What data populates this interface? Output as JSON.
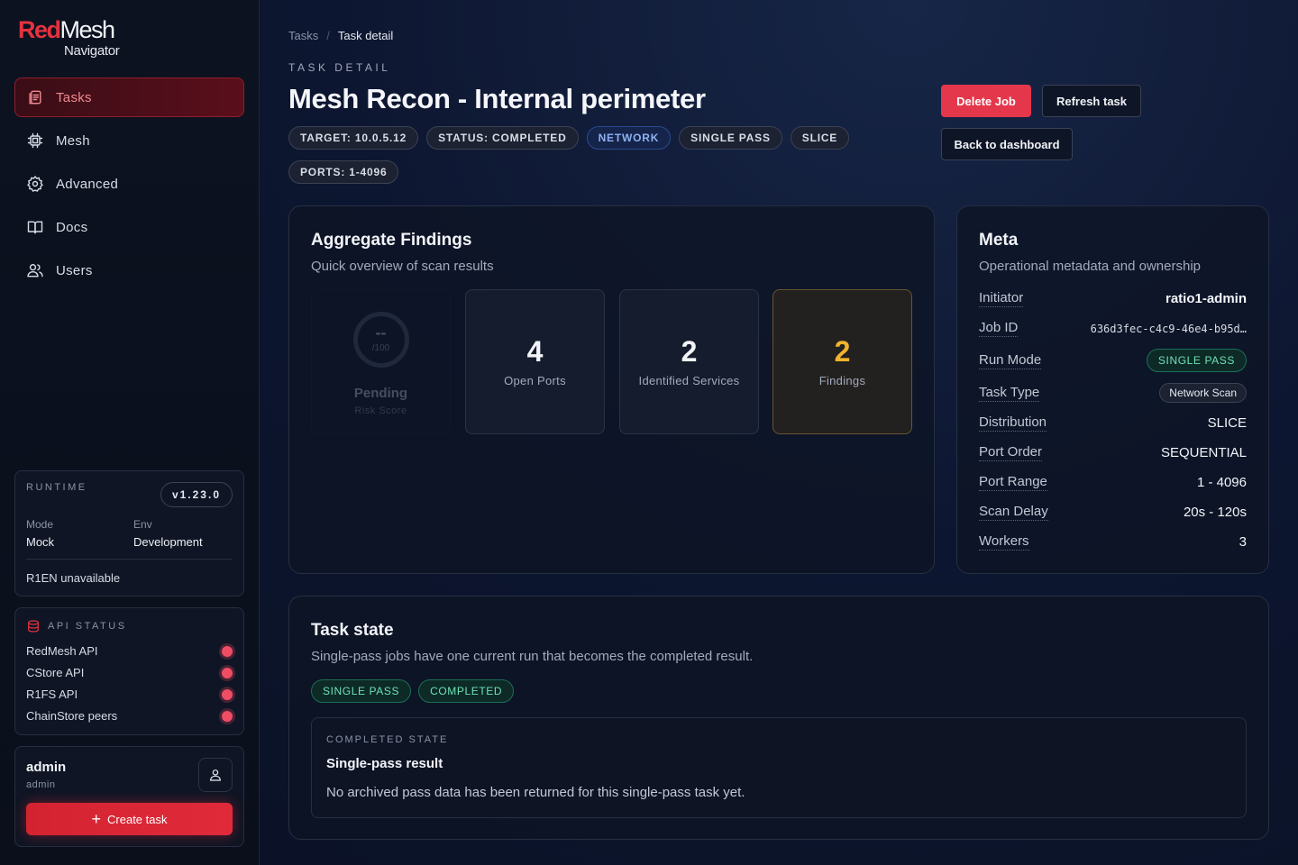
{
  "brand": {
    "part1": "Red",
    "part2": "Mesh",
    "part3": "Navigator"
  },
  "nav": [
    {
      "label": "Tasks",
      "icon": "tasks-icon",
      "active": true
    },
    {
      "label": "Mesh",
      "icon": "chip-icon"
    },
    {
      "label": "Advanced",
      "icon": "gear-icon"
    },
    {
      "label": "Docs",
      "icon": "book-icon"
    },
    {
      "label": "Users",
      "icon": "users-icon"
    }
  ],
  "runtime": {
    "caption": "RUNTIME",
    "version": "v1.23.0",
    "mode_label": "Mode",
    "mode_value": "Mock",
    "env_label": "Env",
    "env_value": "Development",
    "r1en": "R1EN unavailable"
  },
  "api_status": {
    "caption": "API STATUS",
    "items": [
      {
        "label": "RedMesh API",
        "status_color": "#ef4d64"
      },
      {
        "label": "CStore API",
        "status_color": "#ef4d64"
      },
      {
        "label": "R1FS API",
        "status_color": "#ef4d64"
      },
      {
        "label": "ChainStore peers",
        "status_color": "#ef4d64"
      }
    ]
  },
  "user": {
    "name": "admin",
    "role": "admin",
    "create_label": "Create task"
  },
  "breadcrumb": {
    "root": "Tasks",
    "sep": "/",
    "current": "Task detail"
  },
  "header": {
    "eyebrow": "TASK DETAIL",
    "title": "Mesh Recon - Internal perimeter",
    "tags": [
      "TARGET: 10.0.5.12",
      "STATUS: COMPLETED",
      "NETWORK",
      "SINGLE PASS",
      "SLICE",
      "PORTS: 1-4096"
    ],
    "delete_label": "Delete Job",
    "refresh_label": "Refresh task",
    "back_label": "Back to dashboard"
  },
  "aggregate": {
    "title": "Aggregate Findings",
    "subtitle": "Quick overview of scan results",
    "risk": {
      "value": "--",
      "out_of": "/100",
      "label": "Pending",
      "caption": "Risk Score"
    },
    "open_ports": {
      "value": "4",
      "label": "Open Ports"
    },
    "services": {
      "value": "2",
      "label": "Identified Services"
    },
    "findings": {
      "value": "2",
      "label": "Findings"
    }
  },
  "meta": {
    "title": "Meta",
    "subtitle": "Operational metadata and ownership",
    "rows": [
      {
        "key": "Initiator",
        "value": "ratio1-admin"
      },
      {
        "key": "Job ID",
        "value": "636d3fec-c4c9-46e4-b95d…"
      },
      {
        "key": "Run Mode",
        "value": "SINGLE PASS"
      },
      {
        "key": "Task Type",
        "value": "Network Scan"
      },
      {
        "key": "Distribution",
        "value": "SLICE"
      },
      {
        "key": "Port Order",
        "value": "SEQUENTIAL"
      },
      {
        "key": "Port Range",
        "value": "1 - 4096"
      },
      {
        "key": "Scan Delay",
        "value": "20s - 120s"
      },
      {
        "key": "Workers",
        "value": "3"
      }
    ]
  },
  "task_state": {
    "title": "Task state",
    "subtitle": "Single-pass jobs have one current run that becomes the completed result.",
    "pills": [
      "SINGLE PASS",
      "COMPLETED"
    ],
    "box_caption": "COMPLETED STATE",
    "box_title": "Single-pass result",
    "box_text": "No archived pass data has been returned for this single-pass task yet."
  }
}
